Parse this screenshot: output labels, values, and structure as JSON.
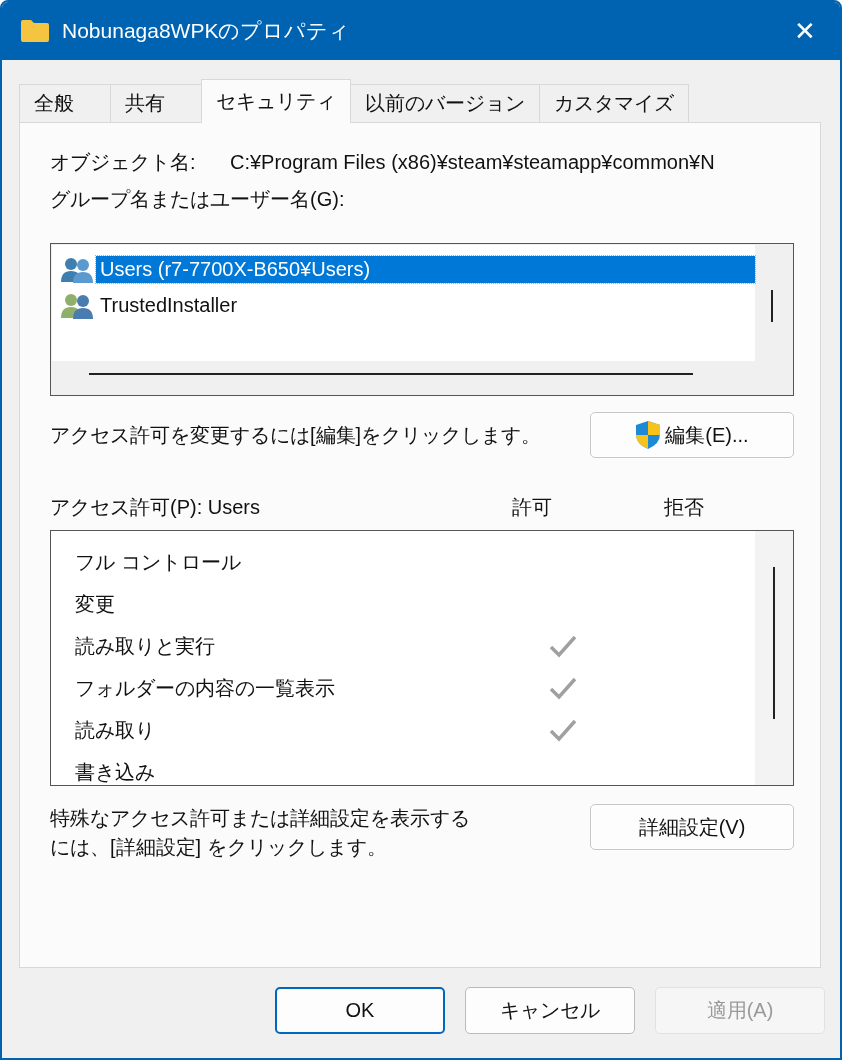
{
  "window": {
    "title": "Nobunaga8WPKのプロパティ",
    "close": "✕"
  },
  "tabs": [
    {
      "label": "全般",
      "selected": false
    },
    {
      "label": "共有",
      "selected": false
    },
    {
      "label": "セキュリティ",
      "selected": true
    },
    {
      "label": "以前のバージョン",
      "selected": false
    },
    {
      "label": "カスタマイズ",
      "selected": false
    }
  ],
  "object_name": {
    "label": "オブジェクト名:",
    "value": "C:¥Program Files (x86)¥steam¥steamapp¥common¥N"
  },
  "group_label": "グループ名またはユーザー名(G):",
  "groups": [
    {
      "name": "Users (r7-7700X-B650¥Users)",
      "selected": true
    },
    {
      "name": "TrustedInstaller",
      "selected": false
    }
  ],
  "edit_hint": "アクセス許可を変更するには[編集]をクリックします。",
  "edit_button": "編集(E)...",
  "permissions": {
    "title": "アクセス許可(P): Users",
    "allow_header": "許可",
    "deny_header": "拒否",
    "rows": [
      {
        "name": "フル コントロール",
        "allow": false,
        "deny": false
      },
      {
        "name": "変更",
        "allow": false,
        "deny": false
      },
      {
        "name": "読み取りと実行",
        "allow": true,
        "deny": false
      },
      {
        "name": "フォルダーの内容の一覧表示",
        "allow": true,
        "deny": false
      },
      {
        "name": "読み取り",
        "allow": true,
        "deny": false
      },
      {
        "name": "書き込み",
        "allow": false,
        "deny": false
      }
    ]
  },
  "advanced_hint": "特殊なアクセス許可または詳細設定を表示するには、[詳細設定] をクリックします。",
  "advanced_button": "詳細設定(V)",
  "buttons": [
    {
      "label": "OK",
      "kind": "default",
      "disabled": false
    },
    {
      "label": "キャンセル",
      "kind": "normal",
      "disabled": false
    },
    {
      "label": "適用(A)",
      "kind": "normal",
      "disabled": true
    }
  ]
}
